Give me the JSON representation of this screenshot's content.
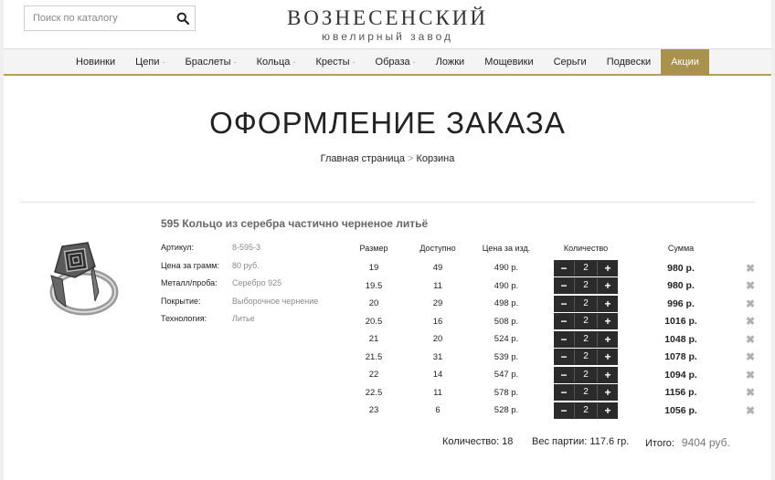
{
  "header": {
    "search_placeholder": "Поиск по каталогу",
    "logo_main": "ВОЗНЕСЕНСКИЙ",
    "logo_sub": "ювелирный завод"
  },
  "nav": {
    "items": [
      {
        "label": "Новинки",
        "arrow": false
      },
      {
        "label": "Цепи",
        "arrow": true
      },
      {
        "label": "Браслеты",
        "arrow": true
      },
      {
        "label": "Кольца",
        "arrow": true
      },
      {
        "label": "Кресты",
        "arrow": true
      },
      {
        "label": "Образа",
        "arrow": true
      },
      {
        "label": "Ложки",
        "arrow": false
      },
      {
        "label": "Мощевики",
        "arrow": false
      },
      {
        "label": "Серьги",
        "arrow": false
      },
      {
        "label": "Подвески",
        "arrow": false
      },
      {
        "label": "Акции",
        "arrow": false,
        "active": true
      }
    ],
    "arrow_glyph": "-"
  },
  "page": {
    "title": "ОФОРМЛЕНИЕ ЗАКАЗА",
    "breadcrumb": {
      "home": "Главная страница",
      "sep": ">",
      "current": "Корзина"
    }
  },
  "product": {
    "name": "595 Кольцо из серебра частично черненое литьё",
    "specs": [
      {
        "key": "Артикул:",
        "value": "8-595-3"
      },
      {
        "key": "Цена за грамм:",
        "value": "80 руб."
      },
      {
        "key": "Металл/проба:",
        "value": "Серебро 925"
      },
      {
        "key": "Покрытие:",
        "value": "Выборочное чернение"
      },
      {
        "key": "Технология:",
        "value": "Литье"
      }
    ]
  },
  "table": {
    "headers": {
      "size": "Размер",
      "available": "Доступно",
      "price": "Цена за изд.",
      "qty": "Количество",
      "sum": "Сумма"
    },
    "rows": [
      {
        "size": "19",
        "available": "49",
        "price": "490 р.",
        "qty": "2",
        "sum": "980 р."
      },
      {
        "size": "19.5",
        "available": "11",
        "price": "490 р.",
        "qty": "2",
        "sum": "980 р."
      },
      {
        "size": "20",
        "available": "29",
        "price": "498 р.",
        "qty": "2",
        "sum": "996 р."
      },
      {
        "size": "20.5",
        "available": "16",
        "price": "508 р.",
        "qty": "2",
        "sum": "1016 р."
      },
      {
        "size": "21",
        "available": "20",
        "price": "524 р.",
        "qty": "2",
        "sum": "1048 р."
      },
      {
        "size": "21.5",
        "available": "31",
        "price": "539 р.",
        "qty": "2",
        "sum": "1078 р."
      },
      {
        "size": "22",
        "available": "14",
        "price": "547 р.",
        "qty": "2",
        "sum": "1094 р."
      },
      {
        "size": "22.5",
        "available": "11",
        "price": "578 р.",
        "qty": "2",
        "sum": "1156 р."
      },
      {
        "size": "23",
        "available": "6",
        "price": "528 р.",
        "qty": "2",
        "sum": "1056 р."
      }
    ],
    "minus": "−",
    "plus": "+",
    "delete": "✖"
  },
  "totals": {
    "qty_label": "Количество: 18",
    "weight_label": "Вес партии: 117.6 гр.",
    "total_label": "Итого:",
    "total_value": "9404 руб."
  },
  "colors": {
    "accent": "#a8924e",
    "stepper": "#2b2b2b"
  },
  "icons": {
    "search": "search-icon",
    "delete": "close-icon",
    "product": "ring-image"
  }
}
